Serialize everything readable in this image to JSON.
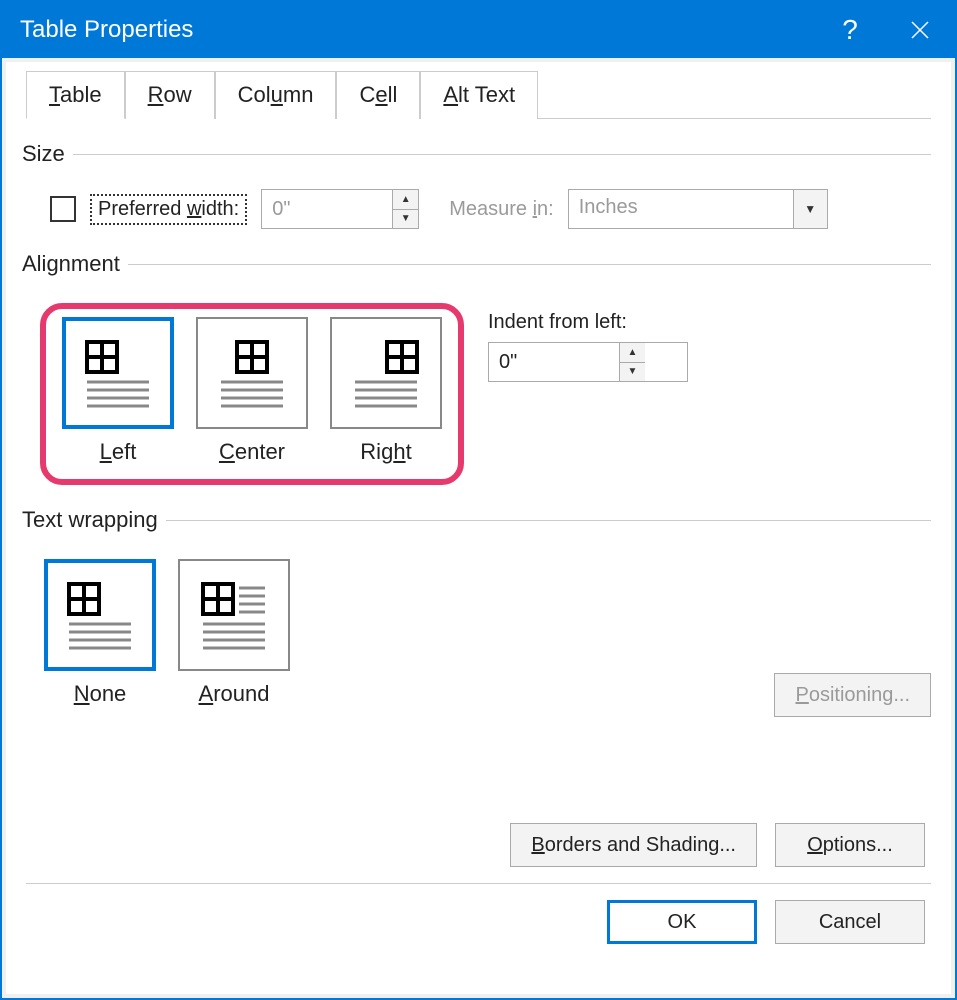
{
  "window": {
    "title": "Table Properties"
  },
  "tabs": {
    "table": "Table",
    "row": "Row",
    "column": "Column",
    "cell": "Cell",
    "alttext": "Alt Text"
  },
  "size": {
    "legend": "Size",
    "preferred_width_label": "Preferred width:",
    "preferred_width_value": "0\"",
    "measure_in_label": "Measure in:",
    "measure_in_value": "Inches"
  },
  "alignment": {
    "legend": "Alignment",
    "left": "Left",
    "center": "Center",
    "right": "Right",
    "indent_label": "Indent from left:",
    "indent_value": "0\""
  },
  "wrapping": {
    "legend": "Text wrapping",
    "none": "None",
    "around": "Around",
    "positioning": "Positioning..."
  },
  "buttons": {
    "borders": "Borders and Shading...",
    "options": "Options...",
    "ok": "OK",
    "cancel": "Cancel"
  }
}
